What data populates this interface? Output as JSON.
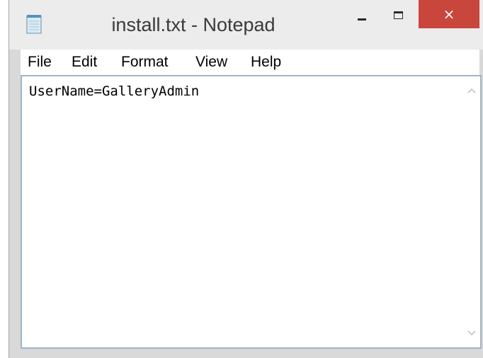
{
  "window": {
    "title": "install.txt - Notepad",
    "icon": "notepad-icon",
    "controls": {
      "minimize": "minimize-icon",
      "maximize": "maximize-icon",
      "close": "×"
    },
    "colors": {
      "close_button": "#c9463d",
      "frame": "#d9d9d9",
      "editor_border": "#9fb4c9"
    }
  },
  "menu": {
    "items": [
      {
        "label": "File"
      },
      {
        "label": "Edit"
      },
      {
        "label": "Format"
      },
      {
        "label": "View"
      },
      {
        "label": "Help"
      }
    ]
  },
  "editor": {
    "content": "UserName=GalleryAdmin"
  }
}
